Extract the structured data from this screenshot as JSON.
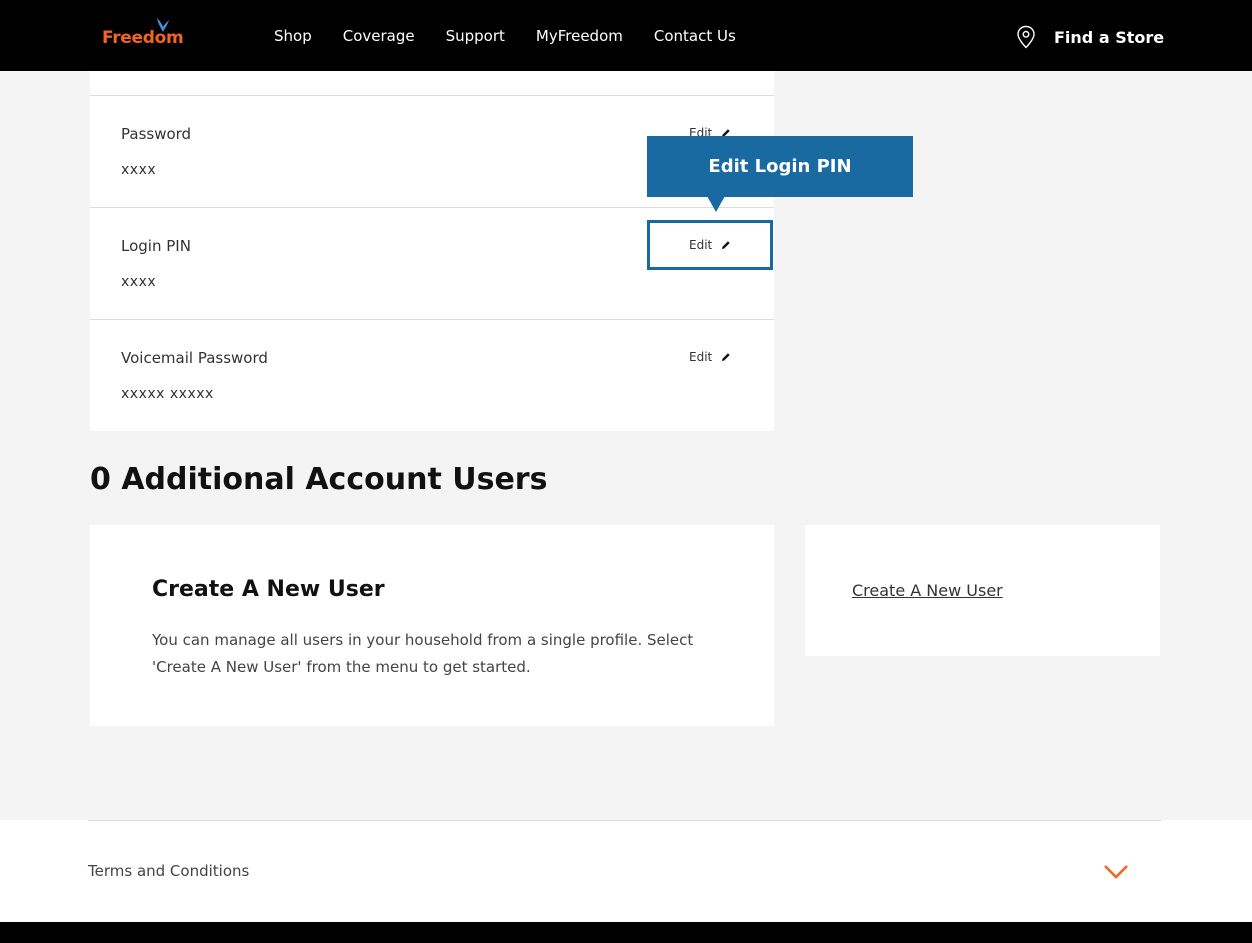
{
  "header": {
    "logo_text": "Freedom",
    "brand_color": "#f26522",
    "accent_color": "#4a90d9",
    "nav": [
      "Shop",
      "Coverage",
      "Support",
      "MyFreedom",
      "Contact Us"
    ],
    "find_store": "Find a Store"
  },
  "settings": {
    "rows": [
      {
        "label": "Password",
        "value": "xxxx",
        "edit": "Edit"
      },
      {
        "label": "Login PIN",
        "value": "xxxx",
        "edit": "Edit"
      },
      {
        "label": "Voicemail Password",
        "value": "xxxxx xxxxx",
        "edit": "Edit"
      }
    ],
    "tooltip": "Edit Login PIN",
    "focus_color": "#1a6aa2"
  },
  "users": {
    "title": "0 Additional Account Users",
    "card_title": "Create A New User",
    "description": "You can manage all users in your household from a single profile. Select 'Create A New User' from the menu to get started.",
    "side_link": "Create A New User"
  },
  "footer": {
    "terms": "Terms and Conditions",
    "chevron_color": "#f26522"
  }
}
